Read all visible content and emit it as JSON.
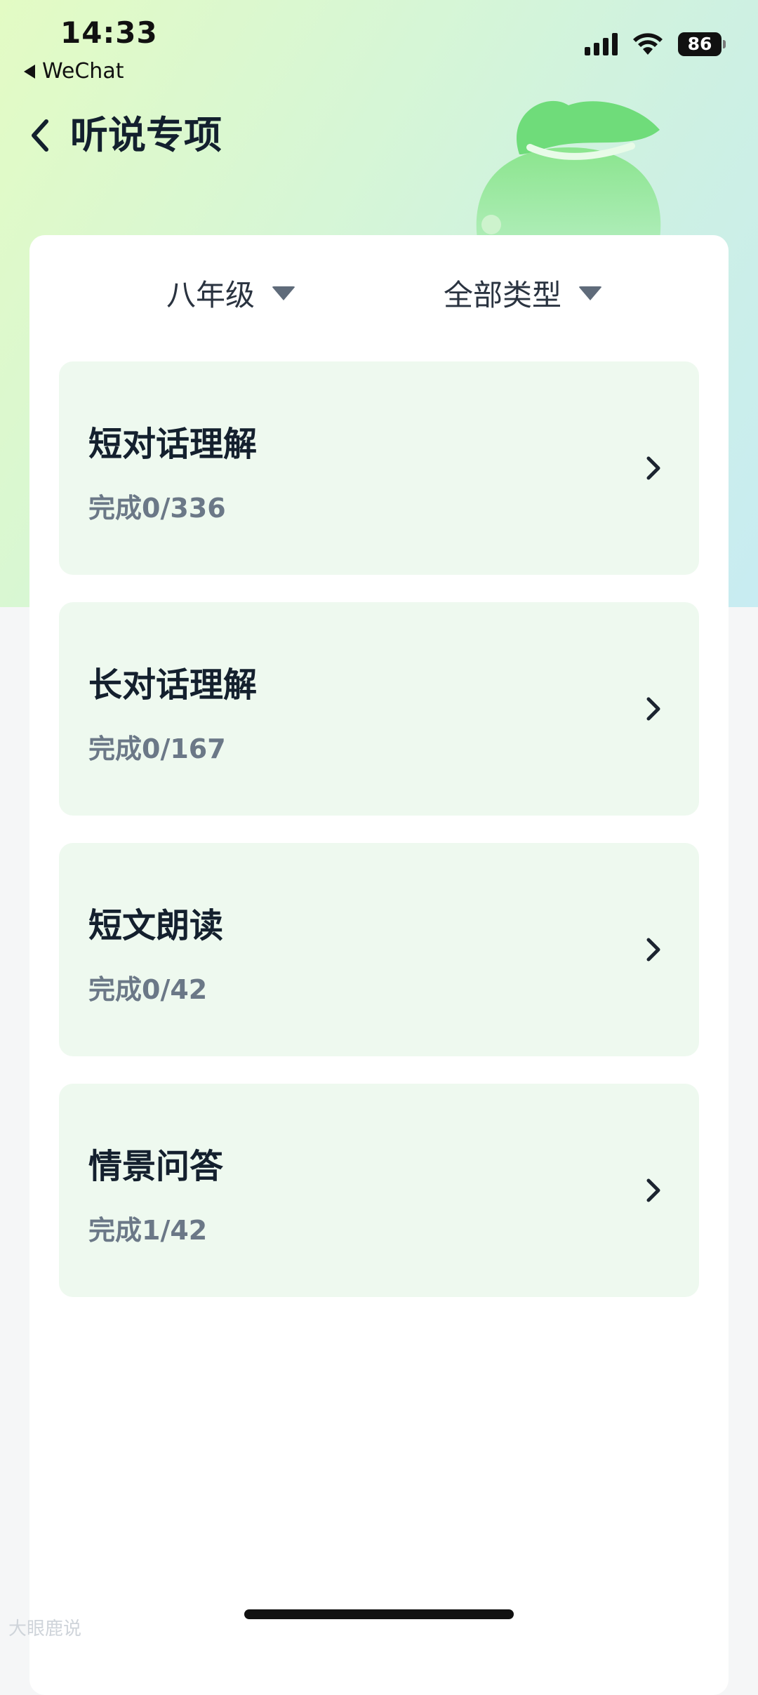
{
  "status_bar": {
    "time": "14:33",
    "back_app": "WeChat",
    "battery": "86"
  },
  "header": {
    "title": "听说专项"
  },
  "filters": {
    "grade": "八年级",
    "type": "全部类型"
  },
  "items": [
    {
      "title": "短对话理解",
      "progress": "完成0/336"
    },
    {
      "title": "长对话理解",
      "progress": "完成0/167"
    },
    {
      "title": "短文朗读",
      "progress": "完成0/42"
    },
    {
      "title": "情景问答",
      "progress": "完成1/42"
    }
  ],
  "colors": {
    "card_item_bg": "#eef9ef",
    "accent_green": "#6fdc7a"
  },
  "watermark": "大眼鹿说"
}
